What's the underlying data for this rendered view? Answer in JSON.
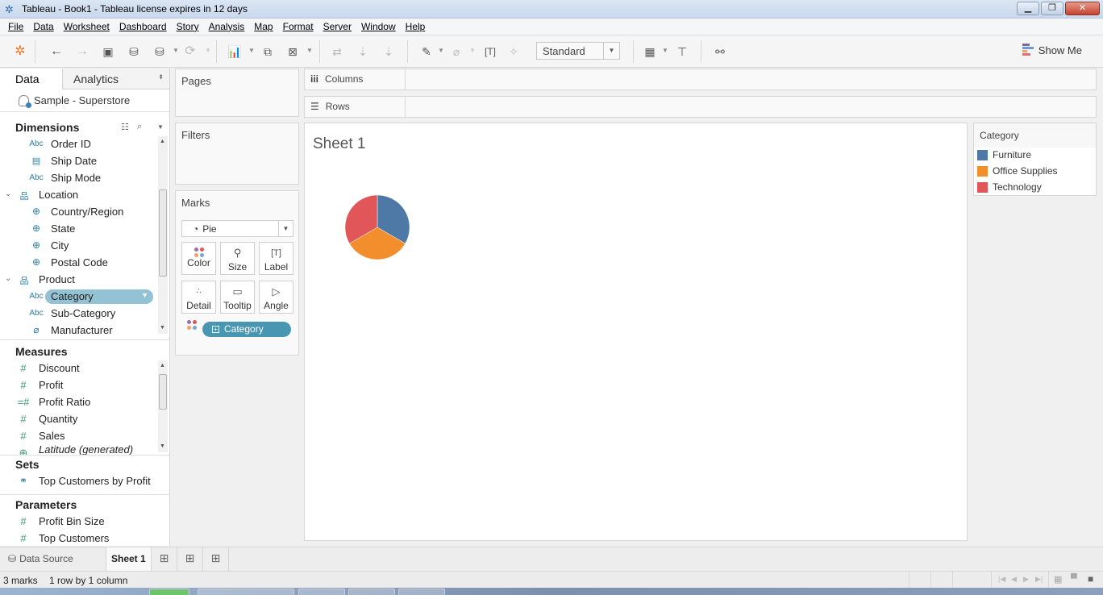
{
  "window": {
    "title": "Tableau - Book1 - Tableau license expires in 12 days"
  },
  "menu": [
    "File",
    "Data",
    "Worksheet",
    "Dashboard",
    "Story",
    "Analysis",
    "Map",
    "Format",
    "Server",
    "Window",
    "Help"
  ],
  "toolbar": {
    "fit_select": "Standard",
    "show_me": "Show Me",
    "icons": [
      "tableau-logo",
      "undo",
      "redo",
      "save",
      "new-data-source",
      "pause-auto-updates",
      "refresh",
      "new-worksheet",
      "duplicate-sheet",
      "clear-sheet",
      "swap-rows-columns",
      "sort-ascending",
      "sort-descending",
      "highlight",
      "group-members",
      "show-mark-labels",
      "fix-axes",
      "cards-view",
      "presentation-mode",
      "share"
    ]
  },
  "left_pane": {
    "tabs": {
      "data": "Data",
      "analytics": "Analytics"
    },
    "data_source": "Sample - Superstore",
    "dimensions": {
      "title": "Dimensions",
      "items": [
        {
          "label": "Order ID",
          "icon": "Abc",
          "type": "string",
          "indent": 2
        },
        {
          "label": "Ship Date",
          "icon": "calendar",
          "type": "date",
          "indent": 2
        },
        {
          "label": "Ship Mode",
          "icon": "Abc",
          "type": "string",
          "indent": 2
        },
        {
          "label": "Location",
          "icon": "hierarchy",
          "type": "hierarchy",
          "indent": 1,
          "expanded": true
        },
        {
          "label": "Country/Region",
          "icon": "globe",
          "type": "geo",
          "indent": 2
        },
        {
          "label": "State",
          "icon": "globe",
          "type": "geo",
          "indent": 2
        },
        {
          "label": "City",
          "icon": "globe",
          "type": "geo",
          "indent": 2
        },
        {
          "label": "Postal Code",
          "icon": "globe",
          "type": "geo",
          "indent": 2
        },
        {
          "label": "Product",
          "icon": "hierarchy",
          "type": "hierarchy",
          "indent": 1,
          "expanded": true
        },
        {
          "label": "Category",
          "icon": "Abc",
          "type": "string",
          "indent": 3,
          "selected": true
        },
        {
          "label": "Sub-Category",
          "icon": "Abc",
          "type": "string",
          "indent": 3
        },
        {
          "label": "Manufacturer",
          "icon": "paperclip",
          "type": "group",
          "indent": 3
        }
      ]
    },
    "measures": {
      "title": "Measures",
      "items": [
        {
          "label": "Discount",
          "icon": "#"
        },
        {
          "label": "Profit",
          "icon": "#"
        },
        {
          "label": "Profit Ratio",
          "icon": "=#"
        },
        {
          "label": "Quantity",
          "icon": "#"
        },
        {
          "label": "Sales",
          "icon": "#"
        },
        {
          "label": "Latitude (generated)",
          "icon": "globe",
          "italic": true
        }
      ]
    },
    "sets": {
      "title": "Sets",
      "items": [
        {
          "label": "Top Customers by Profit"
        }
      ]
    },
    "parameters": {
      "title": "Parameters",
      "items": [
        {
          "label": "Profit Bin Size"
        },
        {
          "label": "Top Customers"
        }
      ]
    }
  },
  "cards": {
    "pages": "Pages",
    "filters": "Filters",
    "marks": {
      "title": "Marks",
      "type": "Pie",
      "buttons": [
        "Color",
        "Size",
        "Label",
        "Detail",
        "Tooltip",
        "Angle"
      ],
      "color_field": "Category"
    }
  },
  "shelves": {
    "columns": "Columns",
    "rows": "Rows"
  },
  "viz": {
    "sheet_title": "Sheet 1"
  },
  "chart_data": {
    "type": "pie",
    "title": "Sheet 1",
    "categories": [
      "Furniture",
      "Office Supplies",
      "Technology"
    ],
    "values": [
      1,
      1,
      1
    ],
    "colors": [
      "#4e79a7",
      "#f28e2b",
      "#e15759"
    ],
    "legend": {
      "title": "Category",
      "position": "right"
    }
  },
  "legend": {
    "title": "Category",
    "items": [
      {
        "label": "Furniture",
        "color": "#4e79a7"
      },
      {
        "label": "Office Supplies",
        "color": "#f28e2b"
      },
      {
        "label": "Technology",
        "color": "#e15759"
      }
    ]
  },
  "sheet_tabs": {
    "data_source": "Data Source",
    "sheet": "Sheet 1"
  },
  "status": {
    "marks": "3 marks",
    "dims": "1 row by 1 column"
  }
}
